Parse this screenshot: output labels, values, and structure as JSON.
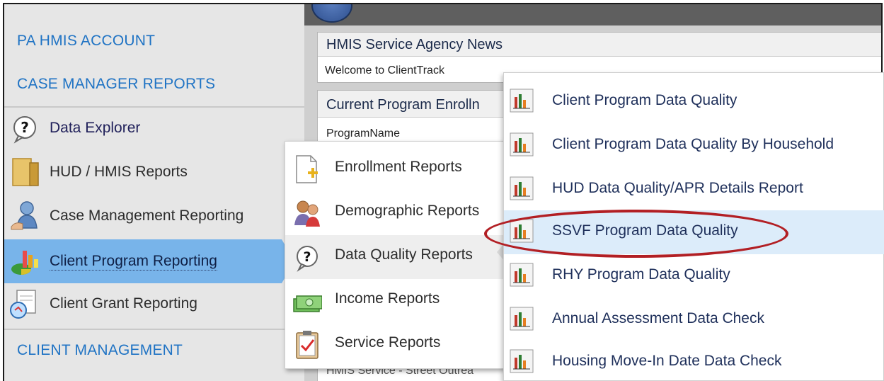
{
  "sidebar": {
    "headings": {
      "account": "PA HMIS ACCOUNT",
      "case_manager_reports": "CASE MANAGER REPORTS",
      "client_management": "CLIENT MANAGEMENT"
    },
    "items": [
      {
        "label": "Data Explorer",
        "icon": "question-bubble-icon"
      },
      {
        "label": "HUD / HMIS Reports",
        "icon": "folder-icon"
      },
      {
        "label": "Case Management Reporting",
        "icon": "person-handshake-icon"
      },
      {
        "label": "Client Program Reporting",
        "icon": "pie-chart-icon",
        "active": true
      },
      {
        "label": "Client Grant Reporting",
        "icon": "grant-report-icon"
      }
    ]
  },
  "main": {
    "news_title": "HMIS Service Agency News",
    "news_body": "Welcome to ClientTrack",
    "enrollment_title": "Current Program Enrolln",
    "enrollment_column": "ProgramName",
    "enrollment_bottom_row": "HMIS Service - Street Outrea"
  },
  "submenu": {
    "items": [
      {
        "label": "Enrollment Reports",
        "icon": "document-add-icon"
      },
      {
        "label": "Demographic Reports",
        "icon": "people-icon"
      },
      {
        "label": "Data Quality Reports",
        "icon": "question-bubble-icon",
        "highlighted": true
      },
      {
        "label": "Income Reports",
        "icon": "money-icon"
      },
      {
        "label": "Service Reports",
        "icon": "clipboard-check-icon"
      }
    ]
  },
  "report_menu": {
    "items": [
      {
        "label": "Client Program Data Quality",
        "icon": "bar-chart-icon"
      },
      {
        "label": "Client Program Data Quality By Household",
        "icon": "bar-chart-icon"
      },
      {
        "label": "HUD Data Quality/APR Details Report",
        "icon": "bar-chart-icon"
      },
      {
        "label": "SSVF Program Data Quality",
        "icon": "bar-chart-icon",
        "highlighted": true,
        "circled": true
      },
      {
        "label": "RHY Program Data Quality",
        "icon": "bar-chart-icon"
      },
      {
        "label": "Annual Assessment Data Check",
        "icon": "bar-chart-icon"
      },
      {
        "label": "Housing Move-In Date Data Check",
        "icon": "bar-chart-icon"
      }
    ]
  },
  "colors": {
    "heading_blue": "#1f73c4",
    "active_item": "#78b4ea",
    "highlight_row": "#dcecfa",
    "annotation_red": "#b21f24"
  }
}
